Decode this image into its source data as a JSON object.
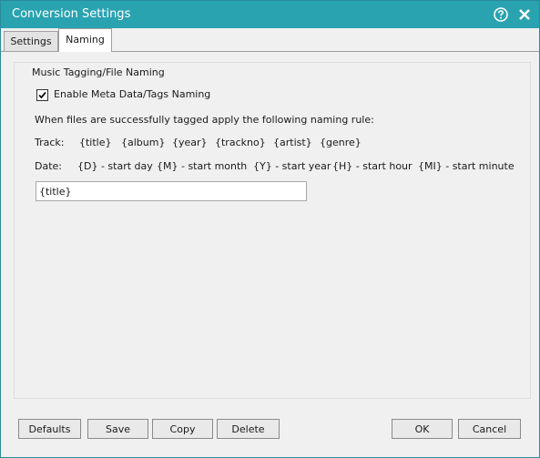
{
  "window": {
    "title": "Conversion Settings"
  },
  "tabs": [
    {
      "label": "Settings"
    },
    {
      "label": "Naming"
    }
  ],
  "group": {
    "title": "Music Tagging/File Naming",
    "checkbox_label": "Enable Meta Data/Tags Naming",
    "checkbox_checked": true,
    "rule_text": "When files are successfully tagged apply the following naming rule:",
    "track_label": "Track:",
    "track_tokens": [
      "{title}",
      "{album}",
      "{year}",
      "{trackno}",
      "{artist}",
      "{genre}"
    ],
    "date_label": "Date:",
    "date_tokens": [
      "{D} - start day",
      "{M} - start month",
      "{Y} - start year",
      "{H} - start hour",
      "{MI} - start minute"
    ],
    "naming_value": "{title}"
  },
  "buttons": {
    "defaults": "Defaults",
    "save": "Save",
    "copy": "Copy",
    "delete": "Delete",
    "ok": "OK",
    "cancel": "Cancel"
  },
  "colors": {
    "titlebar": "#2aa3b0"
  }
}
